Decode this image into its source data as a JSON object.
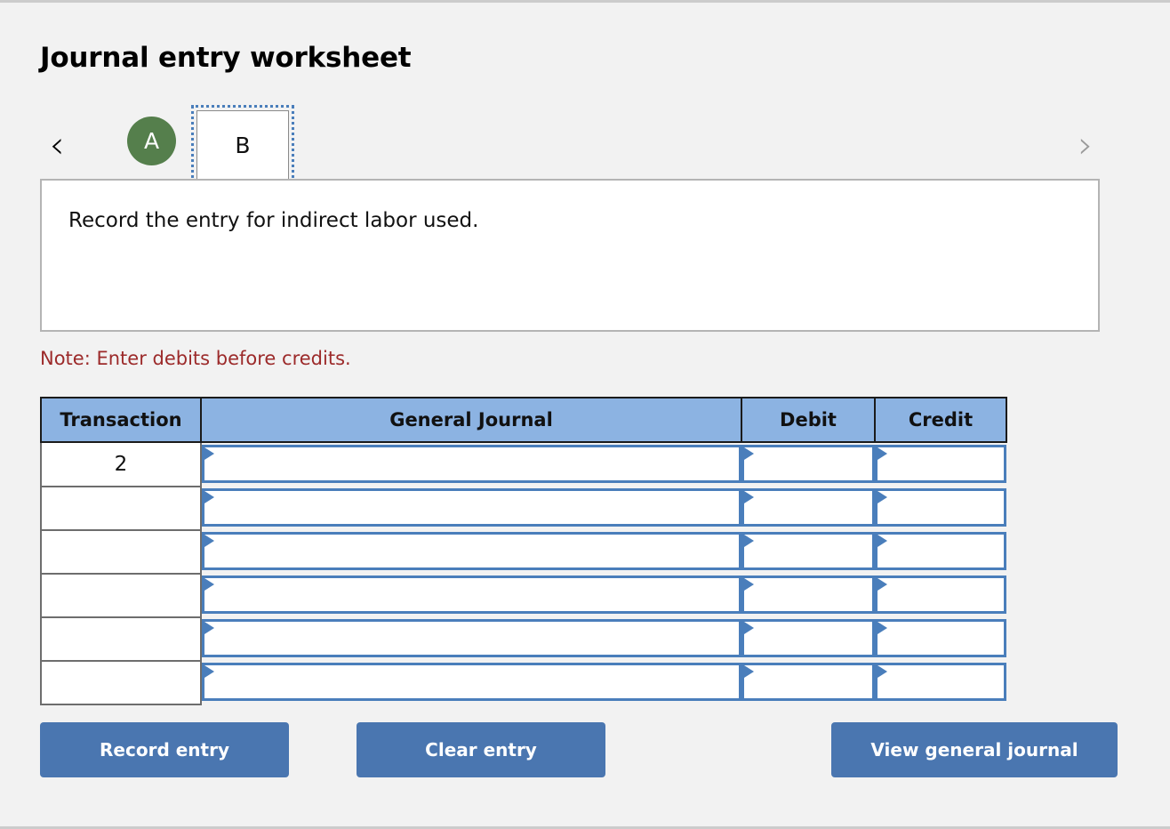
{
  "page": {
    "title": "Journal entry worksheet"
  },
  "tabs": {
    "prev_icon": "chevron-left-icon",
    "next_icon": "chevron-right-icon",
    "prev_label": "‹",
    "next_label": "›",
    "items": [
      {
        "label": "A",
        "state": "completed",
        "color": "#557f4c"
      },
      {
        "label": "B",
        "state": "selected",
        "color": "#ffffff"
      }
    ]
  },
  "instruction": {
    "text": "Record the entry for indirect labor used."
  },
  "note": {
    "text": "Note: Enter debits before credits.",
    "color": "#9c2a2a"
  },
  "table": {
    "headers": {
      "transaction": "Transaction",
      "general_journal": "General Journal",
      "debit": "Debit",
      "credit": "Credit"
    },
    "header_bg": "#8cb3e2",
    "field_border": "#4a7ebb",
    "rows": [
      {
        "transaction": "2",
        "general_journal": "",
        "debit": "",
        "credit": ""
      },
      {
        "transaction": "",
        "general_journal": "",
        "debit": "",
        "credit": ""
      },
      {
        "transaction": "",
        "general_journal": "",
        "debit": "",
        "credit": ""
      },
      {
        "transaction": "",
        "general_journal": "",
        "debit": "",
        "credit": ""
      },
      {
        "transaction": "",
        "general_journal": "",
        "debit": "",
        "credit": ""
      },
      {
        "transaction": "",
        "general_journal": "",
        "debit": "",
        "credit": ""
      }
    ]
  },
  "buttons": {
    "record": "Record entry",
    "clear": "Clear entry",
    "view": "View general journal",
    "color": "#4a76b0"
  }
}
